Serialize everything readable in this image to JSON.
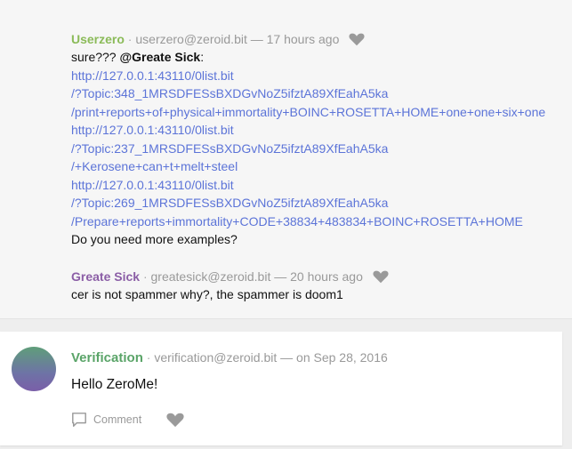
{
  "comments": [
    {
      "author": "Userzero",
      "meta": "userzero@zeroid.bit — 17 hours ago",
      "intro": "sure??? ",
      "mention": "@Greate Sick",
      "mention_suffix": ":",
      "links": [
        "http://127.0.0.1:43110/0list.bit",
        "/?Topic:348_1MRSDFESsBXDGvNoZ5ifztA89XfEahA5ka",
        "/print+reports+of+physical+immortality+BOINC+ROSETTA+HOME+one+one+six+one",
        "http://127.0.0.1:43110/0list.bit",
        "/?Topic:237_1MRSDFESsBXDGvNoZ5ifztA89XfEahA5ka",
        "/+Kerosene+can+t+melt+steel",
        "http://127.0.0.1:43110/0list.bit",
        "/?Topic:269_1MRSDFESsBXDGvNoZ5ifztA89XfEahA5ka",
        "/Prepare+reports+immortality+CODE+38834+483834+BOINC+ROSETTA+HOME"
      ],
      "outro": "Do you need more examples?"
    },
    {
      "author": "Greate Sick",
      "meta": "greatesick@zeroid.bit — 20 hours ago",
      "text": "cer is not spammer why?, the spammer is doom1"
    }
  ],
  "post": {
    "author": "Verification",
    "meta": "verification@zeroid.bit — on Sep 28, 2016",
    "body": "Hello ZeroMe!",
    "comment_label": "Comment"
  },
  "separator": " · ",
  "icons": {
    "like": "heart-icon",
    "comment": "comment-icon"
  },
  "colors": {
    "author_userzero": "#8bbb59",
    "author_greatesick": "#8b5ea6",
    "author_verification": "#5aa468",
    "link": "#5c74d8"
  }
}
